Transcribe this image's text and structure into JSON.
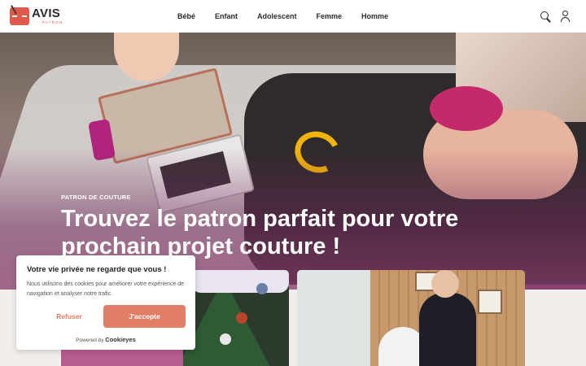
{
  "header": {
    "logo_text": "AVIS",
    "logo_subtext": "PATRON",
    "nav": [
      {
        "label": "Bébé"
      },
      {
        "label": "Enfant"
      },
      {
        "label": "Adolescent"
      },
      {
        "label": "Femme"
      },
      {
        "label": "Homme"
      }
    ],
    "icons": [
      "search-icon",
      "user-icon"
    ]
  },
  "hero": {
    "kicker": "PATRON DE COUTURE",
    "title": "Trouvez le patron parfait pour votre prochain projet couture !"
  },
  "cookie_banner": {
    "title": "Votre vie privée ne regarde que vous !",
    "text": "Nous utilisons des cookies pour améliorer votre expérience de navigation et analyser notre trafic.",
    "refuse_label": "Refuser",
    "accept_label": "J'accepte",
    "powered_prefix": "Powered by",
    "powered_brand": "Cookieyes"
  },
  "colors": {
    "accent": "#e07f66",
    "logo": "#e0594a",
    "text_dark": "#2b2b2b"
  }
}
